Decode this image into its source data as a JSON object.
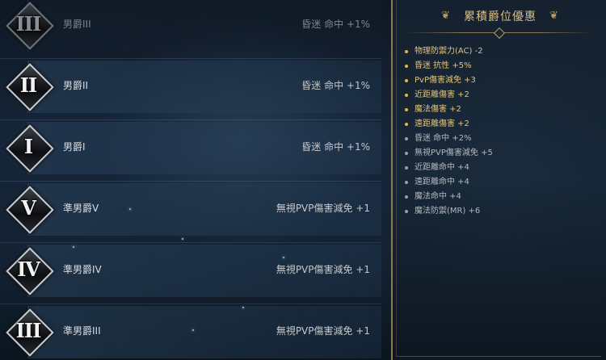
{
  "ranks": [
    {
      "numeral": "III",
      "name": "男爵III",
      "bonus": "昏迷 命中 +1%",
      "state": "dim"
    },
    {
      "numeral": "II",
      "name": "男爵II",
      "bonus": "昏迷 命中 +1%",
      "state": "active"
    },
    {
      "numeral": "I",
      "name": "男爵I",
      "bonus": "昏迷 命中 +1%",
      "state": "active"
    },
    {
      "numeral": "V",
      "name": "準男爵V",
      "bonus": "無視PVP傷害減免 +1",
      "state": "active"
    },
    {
      "numeral": "IV",
      "name": "準男爵IV",
      "bonus": "無視PVP傷害減免 +1",
      "state": "active"
    },
    {
      "numeral": "III",
      "name": "準男爵III",
      "bonus": "無視PVP傷害減免 +1",
      "state": "active"
    }
  ],
  "summary": {
    "title": "累積爵位優惠",
    "items": [
      {
        "text": "物理防禦力(AC) -2",
        "color": "gold"
      },
      {
        "text": "昏迷 抗性 +5%",
        "color": "gold"
      },
      {
        "text": "PvP傷害減免 +3",
        "color": "gold"
      },
      {
        "text": "近距離傷害 +2",
        "color": "gold"
      },
      {
        "text": "魔法傷害 +2",
        "color": "gold"
      },
      {
        "text": "遠距離傷害 +2",
        "color": "gold"
      },
      {
        "text": "昏迷 命中 +2%",
        "color": "grey"
      },
      {
        "text": "無視PVP傷害減免 +5",
        "color": "grey"
      },
      {
        "text": "近距離命中 +4",
        "color": "grey"
      },
      {
        "text": "遠距離命中 +4",
        "color": "grey"
      },
      {
        "text": "魔法命中 +4",
        "color": "grey"
      },
      {
        "text": "魔法防禦(MR) +6",
        "color": "grey"
      }
    ]
  },
  "colors": {
    "gold": "#e2c37a",
    "grey": "#b4b8bd",
    "frame": "#8a7a52"
  }
}
